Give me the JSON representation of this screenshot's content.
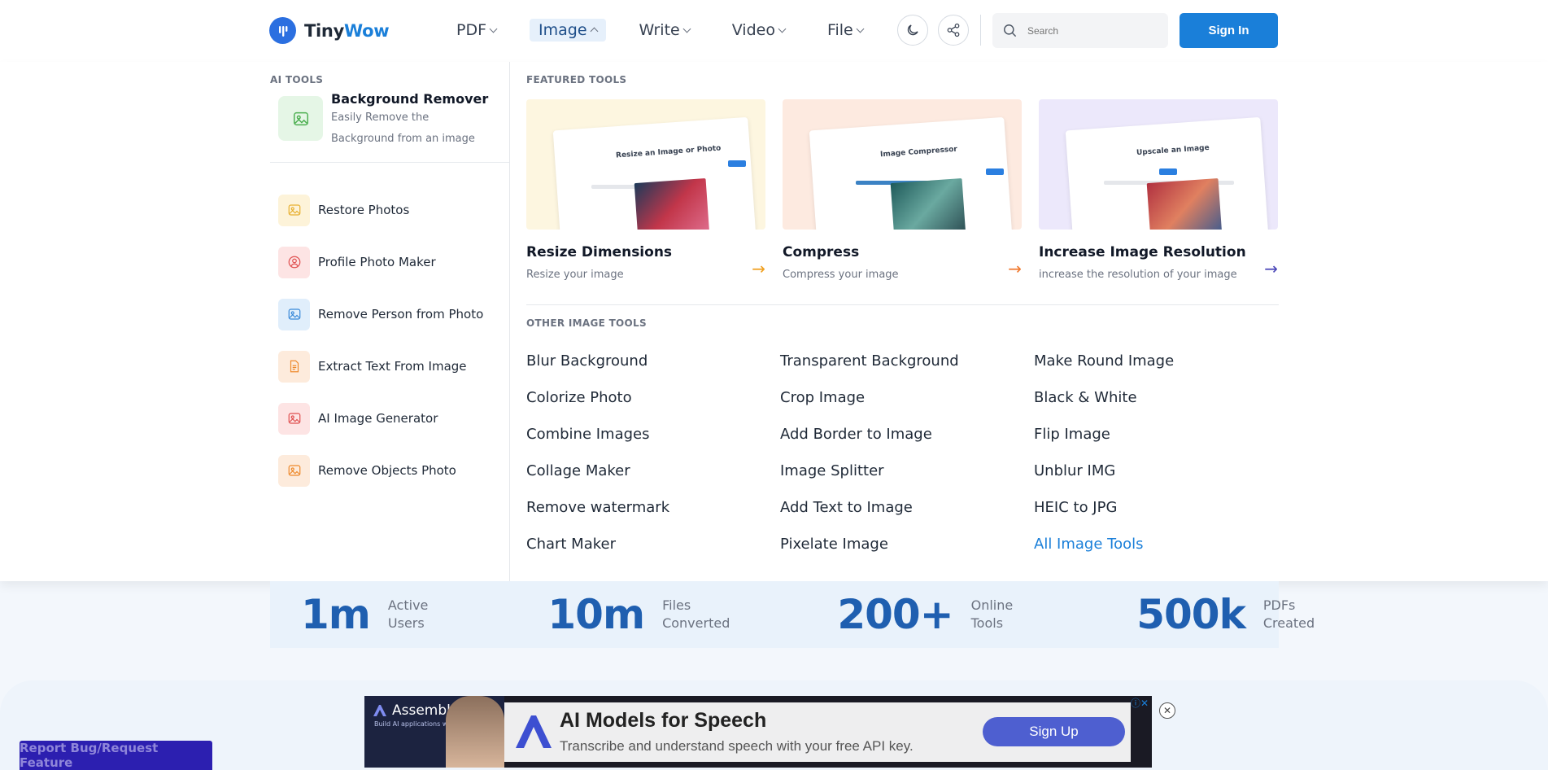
{
  "brand": {
    "name_part1": "Tiny",
    "name_part2": "Wow"
  },
  "nav": [
    {
      "label": "PDF",
      "active": false
    },
    {
      "label": "Image",
      "active": true
    },
    {
      "label": "Write",
      "active": false
    },
    {
      "label": "Video",
      "active": false
    },
    {
      "label": "File",
      "active": false
    }
  ],
  "header": {
    "search_placeholder": "Search",
    "sign_in": "Sign In",
    "theme_icon": "moon-icon",
    "share_icon": "share-icon"
  },
  "menu": {
    "ai_tools_title": "AI TOOLS",
    "featured_ai": {
      "title": "Background Remover",
      "desc_line1": "Easily Remove the",
      "desc_line2": "Background from an image"
    },
    "ai_items": [
      {
        "label": "Restore Photos",
        "color": "#fdf3d9",
        "icon": "image-icon"
      },
      {
        "label": "Profile Photo Maker",
        "color": "#fde4e4",
        "icon": "user-circle-icon"
      },
      {
        "label": "Remove Person from Photo",
        "color": "#e0eefb",
        "icon": "image-icon"
      },
      {
        "label": "Extract Text From Image",
        "color": "#fdebdc",
        "icon": "document-icon"
      },
      {
        "label": "AI Image Generator",
        "color": "#fde4e4",
        "icon": "image-icon"
      },
      {
        "label": "Remove Objects Photo",
        "color": "#fdebdc",
        "icon": "image-icon"
      }
    ],
    "featured_title": "FEATURED TOOLS",
    "featured": [
      {
        "title": "Resize Dimensions",
        "desc": "Resize your image",
        "thumb_heading": "Resize an Image or Photo",
        "bg": "#fdf6e0",
        "arrow_color": "#f0a020"
      },
      {
        "title": "Compress",
        "desc": "Compress your image",
        "thumb_heading": "Image Compressor",
        "bg": "#fdeae0",
        "arrow_color": "#f07a30"
      },
      {
        "title": "Increase Image Resolution",
        "desc": "increase the resolution of your image",
        "thumb_heading": "Upscale an Image",
        "bg": "#ece8fb",
        "arrow_color": "#4b47b8"
      }
    ],
    "other_title": "OTHER IMAGE TOOLS",
    "other_tools": [
      "Blur Background",
      "Transparent Background",
      "Make Round Image",
      "Colorize Photo",
      "Crop Image",
      "Black & White",
      "Combine Images",
      "Add Border to Image",
      "Flip Image",
      "Collage Maker",
      "Image Splitter",
      "Unblur IMG",
      "Remove watermark",
      "Add Text to Image",
      "HEIC to JPG",
      "Chart Maker",
      "Pixelate Image",
      "All Image Tools"
    ]
  },
  "stats": [
    {
      "value": "1m",
      "line1": "Active",
      "line2": "Users"
    },
    {
      "value": "10m",
      "line1": "Files",
      "line2": "Converted"
    },
    {
      "value": "200+",
      "line1": "Online",
      "line2": "Tools"
    },
    {
      "value": "500k",
      "line1": "PDFs",
      "line2": "Created"
    }
  ],
  "ad": {
    "brand": "AssemblyAI",
    "sub": "Build AI applications with voice data",
    "title": "AI Models for Speech",
    "desc": "Transcribe and understand speech with your free API key.",
    "cta": "Sign Up"
  },
  "report": "Report Bug/Request Feature",
  "colors": {
    "accent": "#1a7fd9",
    "stat": "#1f5fb0"
  }
}
